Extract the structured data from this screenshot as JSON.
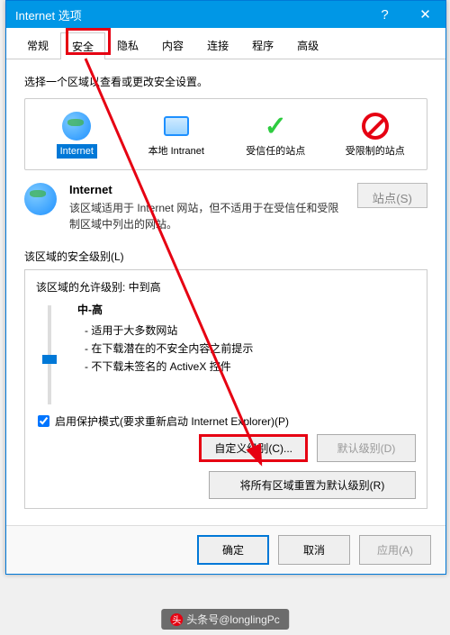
{
  "titlebar": {
    "title": "Internet 选项"
  },
  "tabs": {
    "items": [
      {
        "label": "常规"
      },
      {
        "label": "安全"
      },
      {
        "label": "隐私"
      },
      {
        "label": "内容"
      },
      {
        "label": "连接"
      },
      {
        "label": "程序"
      },
      {
        "label": "高级"
      }
    ],
    "active_index": 1
  },
  "hint": "选择一个区域以查看或更改安全设置。",
  "zones": [
    {
      "id": "internet",
      "label": "Internet",
      "icon": "globe"
    },
    {
      "id": "intranet",
      "label": "本地 Intranet",
      "icon": "pc"
    },
    {
      "id": "trusted",
      "label": "受信任的站点",
      "icon": "check"
    },
    {
      "id": "restricted",
      "label": "受限制的站点",
      "icon": "forbid"
    }
  ],
  "selected_zone_index": 0,
  "zone_detail": {
    "title": "Internet",
    "desc": "该区域适用于 Internet 网站，但不适用于在受信任和受限制区域中列出的网站。",
    "sites_button": "站点(S)"
  },
  "security_level": {
    "group_label": "该区域的安全级别(L)",
    "allowed_label": "该区域的允许级别: 中到高",
    "current": "中-高",
    "bullets": [
      "适用于大多数网站",
      "在下载潜在的不安全内容之前提示",
      "不下载未签名的 ActiveX 控件"
    ]
  },
  "protect_mode": {
    "checked": true,
    "label": "启用保护模式(要求重新启动 Internet Explorer)(P)"
  },
  "buttons": {
    "custom_level": "自定义级别(C)...",
    "default_level": "默认级别(D)",
    "reset_all": "将所有区域重置为默认级别(R)",
    "ok": "确定",
    "cancel": "取消",
    "apply": "应用(A)"
  },
  "watermark": "头条号@longlingPc"
}
